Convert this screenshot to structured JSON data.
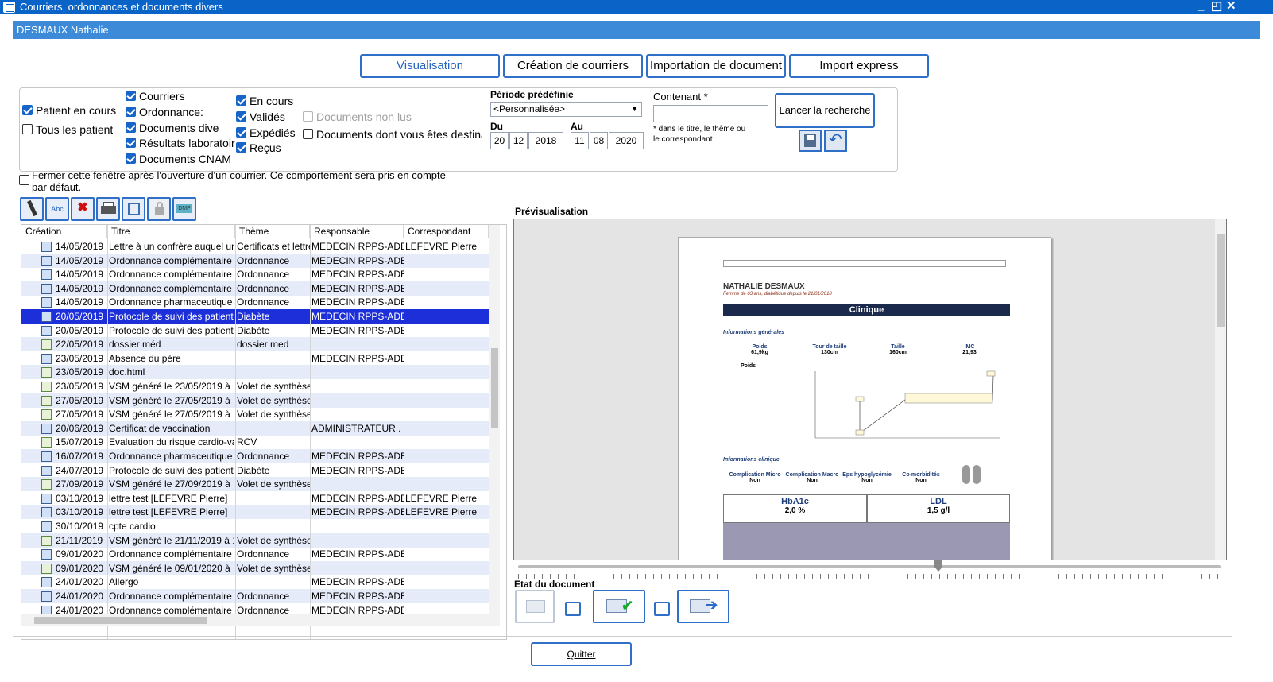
{
  "window": {
    "title": "Courriers, ordonnances et documents divers",
    "controls": [
      "_",
      "◰",
      "✕"
    ]
  },
  "patient": {
    "name": "DESMAUX Nathalie"
  },
  "tabs": [
    "Visualisation",
    "Création de courriers",
    "Importation de document",
    "Import express"
  ],
  "filters": {
    "patient": [
      {
        "label": "Patient en cours",
        "checked": true
      },
      {
        "label": "Tous les patient",
        "checked": false
      }
    ],
    "types": [
      {
        "label": "Courriers",
        "checked": true
      },
      {
        "label": "Ordonnance:",
        "checked": true
      },
      {
        "label": "Documents dive",
        "checked": true
      },
      {
        "label": "Résultats laboratoir",
        "checked": true
      },
      {
        "label": "Documents CNAM",
        "checked": true
      }
    ],
    "status": [
      {
        "label": "En cours",
        "checked": true
      },
      {
        "label": "Validés",
        "checked": true
      },
      {
        "label": "Expédiés",
        "checked": true
      },
      {
        "label": "Reçus",
        "checked": true
      }
    ],
    "docs_non_lus": "Documents non lus",
    "docs_destinataire": "Documents dont vous êtes destinata",
    "periode_label": "Période prédéfinie",
    "periode_value": "<Personnalisée>",
    "du_label": "Du",
    "du": [
      "20",
      "12",
      "2018"
    ],
    "au_label": "Au",
    "au": [
      "11",
      "08",
      "2020"
    ],
    "contenant_label": "Contenant *",
    "contenant_note": "* dans le titre, le thème ou le correspondant",
    "search_button": "Lancer la recherche"
  },
  "close_option": "Fermer cette fenêtre après l'ouverture d'un courrier. Ce comportement sera pris en compte par défaut.",
  "grid": {
    "columns": [
      "Création",
      "Titre",
      "Thème",
      "Responsable",
      "Correspondant"
    ],
    "rows": [
      [
        "14/05/2019",
        "Lettre à un confrère auquel un p...",
        "Certificats et lettre...",
        "MEDECIN RPPS-ADE...",
        "LEFEVRE  Pierre"
      ],
      [
        "14/05/2019",
        "Ordonnance complémentaire",
        "Ordonnance",
        "MEDECIN RPPS-ADE...",
        ""
      ],
      [
        "14/05/2019",
        "Ordonnance complémentaire",
        "Ordonnance",
        "MEDECIN RPPS-ADE...",
        ""
      ],
      [
        "14/05/2019",
        "Ordonnance complémentaire",
        "Ordonnance",
        "MEDECIN RPPS-ADE...",
        ""
      ],
      [
        "14/05/2019",
        "Ordonnance pharmaceutique",
        "Ordonnance",
        "MEDECIN RPPS-ADE...",
        ""
      ],
      [
        "20/05/2019",
        "Protocole de suivi des patients di...",
        "Diabète",
        "MEDECIN RPPS-ADELI",
        ""
      ],
      [
        "20/05/2019",
        "Protocole de suivi des patients di...",
        "Diabète",
        "MEDECIN RPPS-ADELI",
        ""
      ],
      [
        "22/05/2019",
        "dossier méd",
        "dossier med",
        "",
        ""
      ],
      [
        "23/05/2019",
        "Absence du père",
        "",
        "MEDECIN RPPS-ADE...",
        ""
      ],
      [
        "23/05/2019",
        "doc.html",
        "",
        "",
        ""
      ],
      [
        "23/05/2019",
        "VSM généré le 23/05/2019 à 14...",
        "Volet de synthèse ...",
        "",
        ""
      ],
      [
        "27/05/2019",
        "VSM généré le 27/05/2019 à 14...",
        "Volet de synthèse ...",
        "",
        ""
      ],
      [
        "27/05/2019",
        "VSM généré le 27/05/2019 à 14...",
        "Volet de synthèse ...",
        "",
        ""
      ],
      [
        "20/06/2019",
        "Certificat de vaccination",
        "",
        "ADMINISTRATEUR .",
        ""
      ],
      [
        "15/07/2019",
        "Evaluation du risque cardio-vasc...",
        "RCV",
        "",
        ""
      ],
      [
        "16/07/2019",
        "Ordonnance pharmaceutique",
        "Ordonnance",
        "MEDECIN RPPS-ADE...",
        ""
      ],
      [
        "24/07/2019",
        "Protocole de suivi des patients di...",
        "Diabète",
        "MEDECIN RPPS-ADELI",
        ""
      ],
      [
        "27/09/2019",
        "VSM généré le 27/09/2019 à 15...",
        "Volet de synthèse ...",
        "",
        ""
      ],
      [
        "03/10/2019",
        "lettre test [LEFEVRE  Pierre]",
        "",
        "MEDECIN RPPS-ADE...",
        "LEFEVRE  Pierre"
      ],
      [
        "03/10/2019",
        "lettre test [LEFEVRE  Pierre]",
        "",
        "MEDECIN RPPS-ADE...",
        "LEFEVRE  Pierre"
      ],
      [
        "30/10/2019",
        "cpte cardio",
        "",
        "",
        ""
      ],
      [
        "21/11/2019",
        "VSM généré le 21/11/2019 à 16...",
        "Volet de synthèse ...",
        "",
        ""
      ],
      [
        "09/01/2020",
        "Ordonnance complémentaire",
        "Ordonnance",
        "MEDECIN RPPS-ADE...",
        ""
      ],
      [
        "09/01/2020",
        "VSM généré le 09/01/2020 à 16...",
        "Volet de synthèse ...",
        "",
        ""
      ],
      [
        "24/01/2020",
        "Allergo",
        "",
        "MEDECIN RPPS-ADE...",
        ""
      ],
      [
        "24/01/2020",
        "Ordonnance complémentaire",
        "Ordonnance",
        "MEDECIN RPPS-ADE...",
        ""
      ],
      [
        "24/01/2020",
        "Ordonnance complémentaire",
        "Ordonnance",
        "MEDECIN RPPS-ADE...",
        ""
      ]
    ],
    "selected_index": 5
  },
  "preview": {
    "label": "Prévisualisation",
    "doc": {
      "name": "NATHALIE DESMAUX",
      "subtitle": "Femme de 63 ans, diabétique depuis le 21/01/2018",
      "section": "Clinique",
      "general": "Informations générales",
      "metrics": [
        {
          "label": "Poids",
          "value": "61,9kg"
        },
        {
          "label": "Tour de taille",
          "value": "130cm"
        },
        {
          "label": "Taille",
          "value": "160cm"
        },
        {
          "label": "IMC",
          "value": "21,93"
        }
      ],
      "chart_label": "Poids",
      "clinique": "Informations clinique",
      "complications": [
        {
          "label": "Complication Micro",
          "value": "Non"
        },
        {
          "label": "Complication Macro",
          "value": "Non"
        },
        {
          "label": "Eps hypoglycémie",
          "value": "Non"
        },
        {
          "label": "Co-morbidités",
          "value": "Non"
        }
      ],
      "hba1c": {
        "label": "HbA1c",
        "value": "2,0 %"
      },
      "ldl": {
        "label": "LDL",
        "value": "1,5 g/l"
      }
    }
  },
  "etat_label": "Etat du document",
  "quit": "Quitter"
}
